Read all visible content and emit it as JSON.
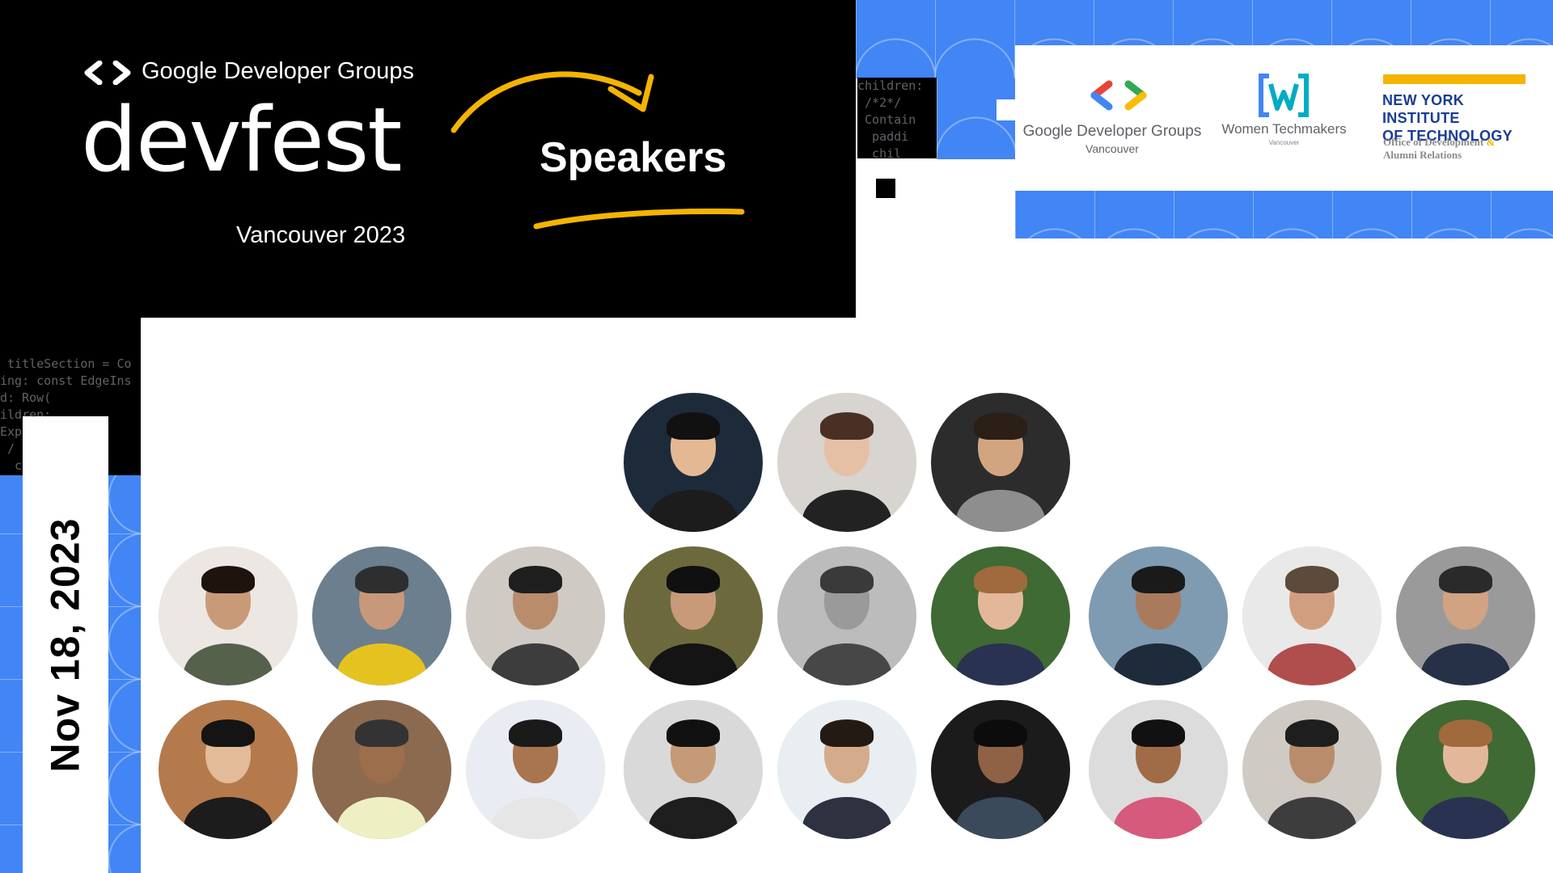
{
  "header": {
    "org_name": "Google Developer Groups",
    "event_name": "devfest",
    "event_subtitle": "Vancouver 2023",
    "section_title": "Speakers"
  },
  "date": "Nov 18, 2023",
  "code_snippets": {
    "top": "children:\n /*2*/\n Contain\n  paddi\n  chil",
    "left": " titleSection = Co\ning: const EdgeIns\nd: Row(\nildren:\nExpanded(\n /\n  c"
  },
  "logos": {
    "gdg": {
      "name": "Google Developer Groups",
      "sub": "Vancouver"
    },
    "wtm": {
      "name": "Women Techmakers",
      "sub": "Vancouver"
    },
    "nyit": {
      "name_line1": "NEW YORK INSTITUTE",
      "name_line2": "OF TECHNOLOGY",
      "office_line1": "Office of Development",
      "office_amp": "&",
      "office_line2": "Alumni Relations"
    }
  },
  "colors": {
    "blue": "#4285f4",
    "black": "#000000",
    "yellow": "#f4b400",
    "nyit_blue": "#1a3c96"
  },
  "speakers": [
    {
      "row": 1,
      "col": 4,
      "bg": "#1d2a3a",
      "skin": "#e4b893",
      "hair": "#111111",
      "shirt": "#1c1c1c"
    },
    {
      "row": 1,
      "col": 5,
      "bg": "#d8d4d0",
      "skin": "#e6c0a5",
      "hair": "#4a3024",
      "shirt": "#222222"
    },
    {
      "row": 1,
      "col": 6,
      "bg": "#2c2c2c",
      "skin": "#d2a581",
      "hair": "#2b1f18",
      "shirt": "#8e8e8e"
    },
    {
      "row": 2,
      "col": 1,
      "bg": "#ece7e3",
      "skin": "#c99a77",
      "hair": "#1e130d",
      "shirt": "#55614b"
    },
    {
      "row": 2,
      "col": 2,
      "bg": "#6b7f8e",
      "skin": "#c8987a",
      "hair": "#2e2e2e",
      "shirt": "#e6c21f"
    },
    {
      "row": 2,
      "col": 3,
      "bg": "#cfcac4",
      "skin": "#b98d6b",
      "hair": "#1e1e1e",
      "shirt": "#3d3d3d"
    },
    {
      "row": 2,
      "col": 4,
      "bg": "#6c6a3d",
      "skin": "#c89a7a",
      "hair": "#101010",
      "shirt": "#141414"
    },
    {
      "row": 2,
      "col": 5,
      "bg": "#bcbcbc",
      "skin": "#9a9a9a",
      "hair": "#3a3a3a",
      "shirt": "#474747"
    },
    {
      "row": 2,
      "col": 6,
      "bg": "#3f6a33",
      "skin": "#e3b79a",
      "hair": "#a06a3c",
      "shirt": "#2a3252"
    },
    {
      "row": 2,
      "col": 7,
      "bg": "#7f9bb2",
      "skin": "#a97b5c",
      "hair": "#1a1a1a",
      "shirt": "#1d2b3a"
    },
    {
      "row": 2,
      "col": 8,
      "bg": "#e9e9e9",
      "skin": "#d19f80",
      "hair": "#5c4a3a",
      "shirt": "#b04d4d"
    },
    {
      "row": 2,
      "col": 9,
      "bg": "#9a9a9a",
      "skin": "#d2a383",
      "hair": "#2a2a2a",
      "shirt": "#263147"
    },
    {
      "row": 3,
      "col": 1,
      "bg": "#b47a4c",
      "skin": "#e3bb98",
      "hair": "#141414",
      "shirt": "#1c1c1c"
    },
    {
      "row": 3,
      "col": 2,
      "bg": "#8c6a4f",
      "skin": "#9c6e4c",
      "hair": "#333333",
      "shirt": "#eef0c4"
    },
    {
      "row": 3,
      "col": 3,
      "bg": "#e9ecf2",
      "skin": "#a8754f",
      "hair": "#1a1a1a",
      "shirt": "#e6e6e6"
    },
    {
      "row": 3,
      "col": 4,
      "bg": "#d9d9d9",
      "skin": "#c59a78",
      "hair": "#111111",
      "shirt": "#1e1e1e"
    },
    {
      "row": 3,
      "col": 5,
      "bg": "#e8eef2",
      "skin": "#d5ac8b",
      "hair": "#241a14",
      "shirt": "#2d3140"
    },
    {
      "row": 3,
      "col": 6,
      "bg": "#1b1b1b",
      "skin": "#8f6246",
      "hair": "#0c0c0c",
      "shirt": "#3a4a5a"
    },
    {
      "row": 3,
      "col": 7,
      "bg": "#dcdcdc",
      "skin": "#a06c47",
      "hair": "#111111",
      "shirt": "#d55a7b"
    },
    {
      "row": 3,
      "col": 8,
      "bg": "#cfcac4",
      "skin": "#b98d6b",
      "hair": "#1e1e1e",
      "shirt": "#3d3d3d"
    },
    {
      "row": 3,
      "col": 9,
      "bg": "#3f6a33",
      "skin": "#e3b79a",
      "hair": "#a06a3c",
      "shirt": "#2a3252"
    }
  ]
}
